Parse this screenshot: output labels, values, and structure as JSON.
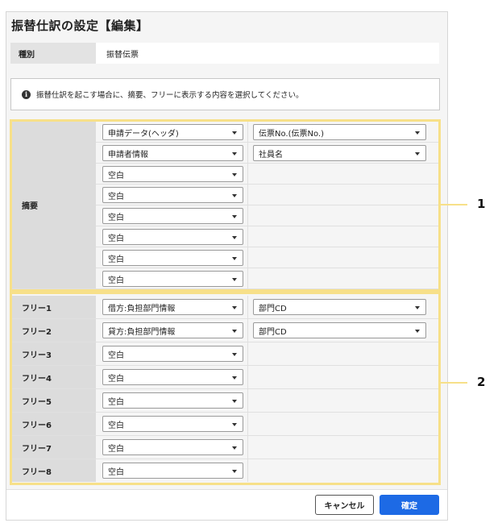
{
  "title": "振替仕訳の設定【編集】",
  "type_row": {
    "label": "種別",
    "value": "振替伝票"
  },
  "info": {
    "icon": "info-icon",
    "text": "振替仕訳を起こす場合に、摘要、フリーに表示する内容を選択してください。"
  },
  "summary": {
    "label": "摘要",
    "rows": [
      {
        "select1": "申請データ(ヘッダ)",
        "select2": "伝票No.(伝票No.)"
      },
      {
        "select1": "申請者情報",
        "select2": "社員名"
      },
      {
        "select1": "空白"
      },
      {
        "select1": "空白"
      },
      {
        "select1": "空白"
      },
      {
        "select1": "空白"
      },
      {
        "select1": "空白"
      },
      {
        "select1": "空白"
      }
    ]
  },
  "free": [
    {
      "label": "フリー1",
      "select1": "借方:負担部門情報",
      "select2": "部門CD"
    },
    {
      "label": "フリー2",
      "select1": "貸方:負担部門情報",
      "select2": "部門CD"
    },
    {
      "label": "フリー3",
      "select1": "空白"
    },
    {
      "label": "フリー4",
      "select1": "空白"
    },
    {
      "label": "フリー5",
      "select1": "空白"
    },
    {
      "label": "フリー6",
      "select1": "空白"
    },
    {
      "label": "フリー7",
      "select1": "空白"
    },
    {
      "label": "フリー8",
      "select1": "空白"
    }
  ],
  "callouts": [
    "1",
    "2"
  ],
  "buttons": {
    "cancel": "キャンセル",
    "ok": "確定"
  },
  "colors": {
    "highlight": "#f7e089",
    "primary": "#1d6ae5",
    "label_bg": "#dcdcdc"
  }
}
